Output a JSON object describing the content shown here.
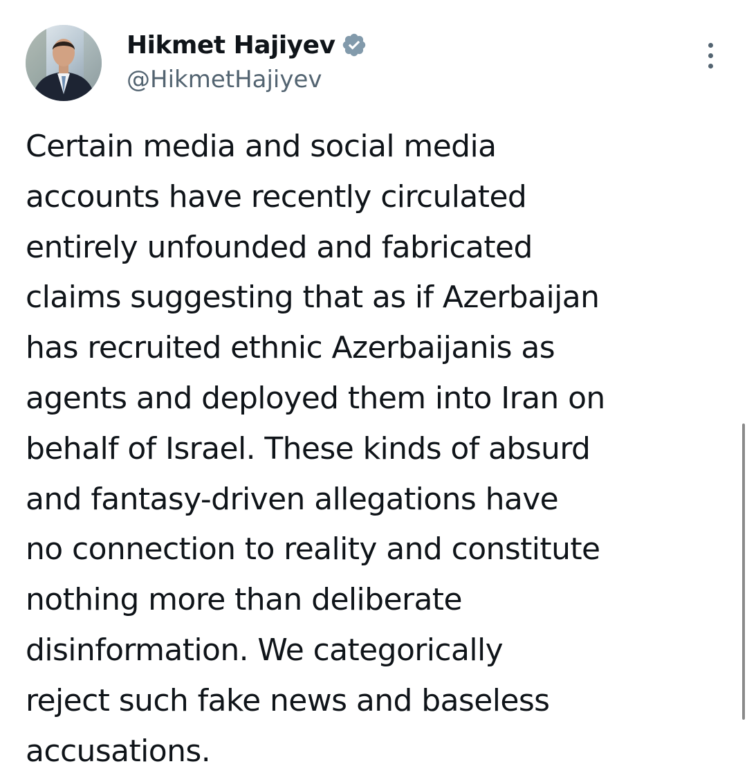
{
  "author": {
    "display_name": "Hikmet Hajiyev",
    "handle": "@HikmetHajiyev",
    "verified": true,
    "verified_badge_color": "#829aab"
  },
  "tweet": {
    "text_lines": [
      "Certain media and social media",
      "accounts have recently circulated",
      "entirely unfounded and fabricated",
      "claims suggesting that as if Azerbaijan",
      "has recruited ethnic Azerbaijanis as",
      "agents and deployed them into Iran on",
      "behalf of Israel. These kinds of absurd",
      "and fantasy-driven allegations have",
      "no connection to reality and constitute",
      "nothing more than deliberate",
      "disinformation. We categorically",
      "reject such fake news and baseless",
      "accusations."
    ]
  },
  "icons": {
    "verified": "verified-badge-icon",
    "more": "more-options-icon"
  },
  "colors": {
    "text_primary": "#0f1419",
    "text_secondary": "#536471",
    "background": "#ffffff"
  }
}
